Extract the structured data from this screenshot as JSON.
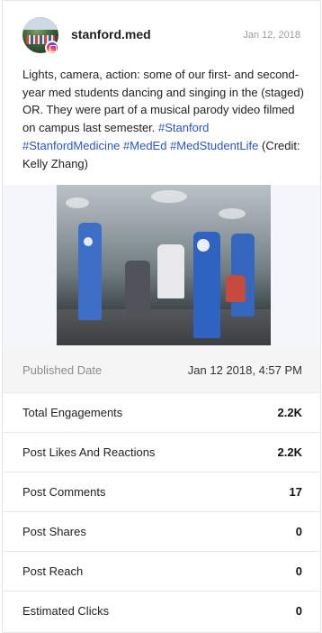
{
  "post": {
    "username": "stanford.med",
    "date": "Jan 12, 2018",
    "caption_text": "Lights, camera, action: some of our first- and second-year med students dancing and singing in the (staged) OR. They were part of a musical parody video filmed on campus last semester. ",
    "hashtags": [
      "#Stanford",
      "#StanfordMedicine",
      "#MedEd",
      "#MedStudentLife"
    ],
    "caption_credit": " (Credit: Kelly Zhang)",
    "platform_icon": "instagram-icon",
    "media_icon": "photo"
  },
  "stats": {
    "published": {
      "label": "Published Date",
      "value": "Jan 12 2018, 4:57 PM"
    },
    "rows": [
      {
        "label": "Total Engagements",
        "value": "2.2K"
      },
      {
        "label": "Post Likes And Reactions",
        "value": "2.2K"
      },
      {
        "label": "Post Comments",
        "value": "17"
      },
      {
        "label": "Post Shares",
        "value": "0"
      },
      {
        "label": "Post Reach",
        "value": "0"
      },
      {
        "label": "Estimated Clicks",
        "value": "0"
      }
    ]
  },
  "colors": {
    "hashtag": "#2a55c6",
    "muted": "#9a9a9a",
    "published_bg": "#f5f5f5"
  }
}
